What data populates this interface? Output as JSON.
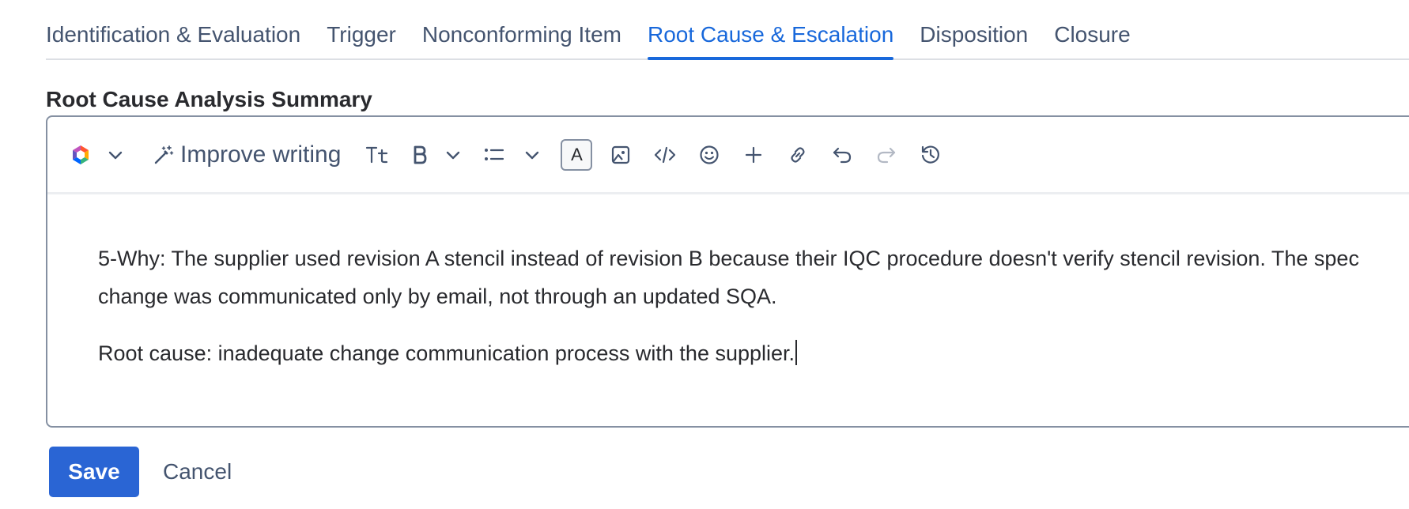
{
  "tabs": [
    {
      "label": "Identification & Evaluation",
      "active": false
    },
    {
      "label": "Trigger",
      "active": false
    },
    {
      "label": "Nonconforming Item",
      "active": false
    },
    {
      "label": "Root Cause & Escalation",
      "active": true
    },
    {
      "label": "Disposition",
      "active": false
    },
    {
      "label": "Closure",
      "active": false
    }
  ],
  "field": {
    "label": "Root Cause Analysis Summary"
  },
  "toolbar": {
    "ai_icon": "ai-assistant-icon",
    "improve_writing_label": "Improve writing",
    "text_color_label": "A",
    "icons": [
      "ai-assistant-icon",
      "chevron-down-icon",
      "magic-wand-icon",
      "text-size-icon",
      "bold-icon",
      "list-icon",
      "text-color-icon",
      "image-icon",
      "code-icon",
      "emoji-icon",
      "plus-icon",
      "link-icon",
      "undo-icon",
      "redo-icon",
      "history-icon"
    ]
  },
  "editor": {
    "paragraphs": [
      "5-Why: The supplier used revision A stencil instead of revision B because their IQC procedure doesn't verify stencil revision. The spec change was communicated only by email, not through an updated SQA.",
      "Root cause: inadequate change communication process with the supplier."
    ]
  },
  "actions": {
    "save_label": "Save",
    "cancel_label": "Cancel"
  },
  "colors": {
    "accent": "#1868db",
    "primary_button": "#2a65d4",
    "text": "#292a2e",
    "subtle_text": "#44546f"
  }
}
